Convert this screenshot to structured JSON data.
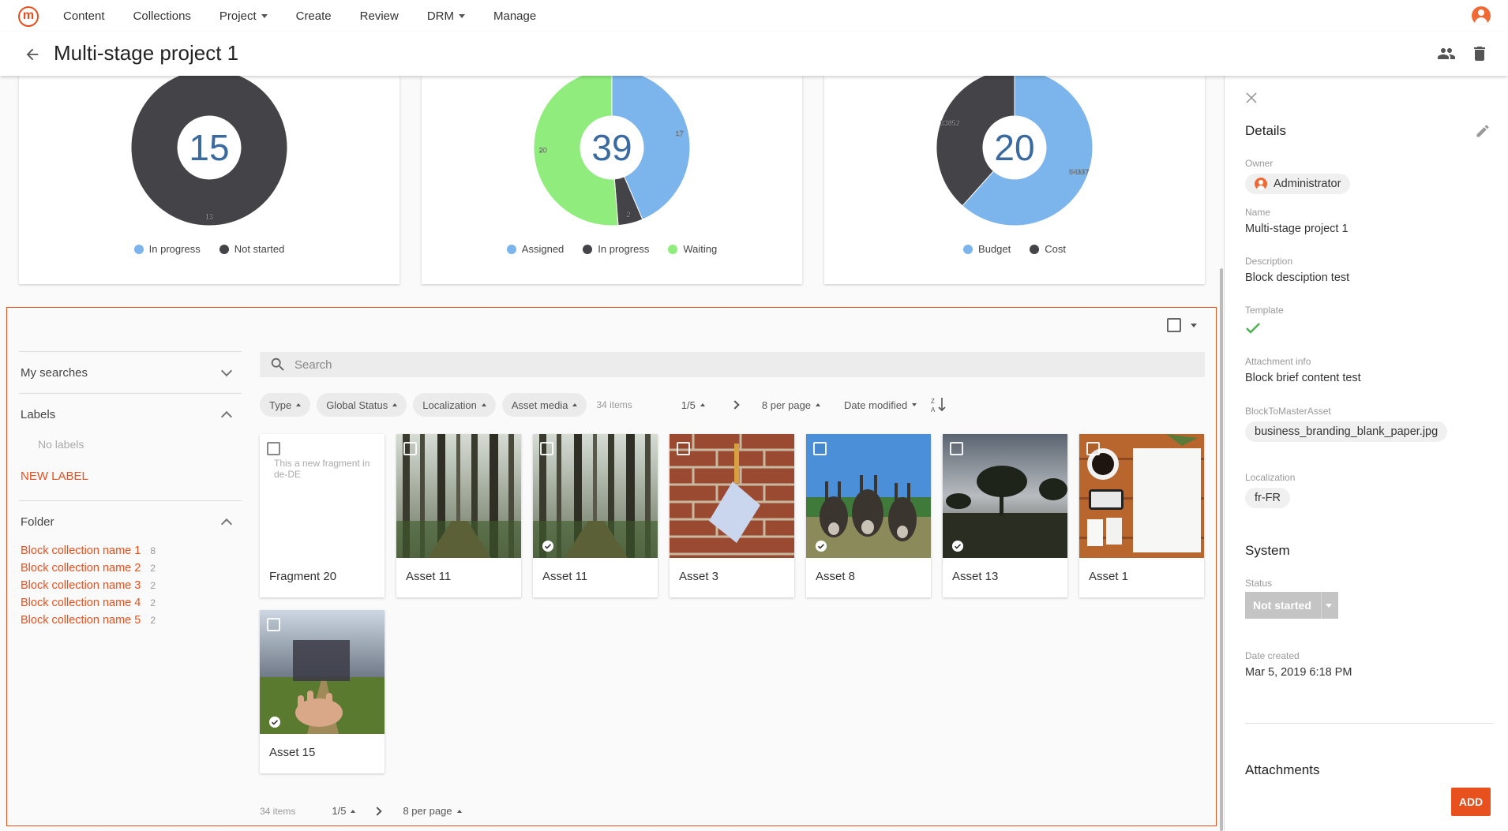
{
  "nav": {
    "logo": "m",
    "items": [
      {
        "label": "Content",
        "caret": false
      },
      {
        "label": "Collections",
        "caret": false
      },
      {
        "label": "Project",
        "caret": true
      },
      {
        "label": "Create",
        "caret": false
      },
      {
        "label": "Review",
        "caret": false
      },
      {
        "label": "DRM",
        "caret": true
      },
      {
        "label": "Manage",
        "caret": false
      }
    ]
  },
  "header": {
    "title": "Multi-stage project 1"
  },
  "charts": {
    "chart_data": [
      {
        "type": "pie",
        "center_label": "15",
        "slices": [
          {
            "label": "In progress",
            "value": 0,
            "color": "#7cb5ec"
          },
          {
            "label": "Not started",
            "value": 13,
            "color": "#434348"
          }
        ],
        "data_labels": [
          "13"
        ],
        "legend": [
          "In progress",
          "Not started"
        ]
      },
      {
        "type": "pie",
        "center_label": "39",
        "slices": [
          {
            "label": "Assigned",
            "value": 17,
            "color": "#7cb5ec"
          },
          {
            "label": "In progress",
            "value": 2,
            "color": "#434348"
          },
          {
            "label": "Waiting",
            "value": 20,
            "color": "#90ed7d"
          }
        ],
        "data_labels": [
          "17",
          "2",
          "20"
        ],
        "legend": [
          "Assigned",
          "In progress",
          "Waiting"
        ]
      },
      {
        "type": "pie",
        "center_label": "20",
        "slices": [
          {
            "label": "Budget",
            "value": 54337,
            "color": "#7cb5ec"
          },
          {
            "label": "Cost",
            "value": 33852,
            "color": "#434348"
          }
        ],
        "data_labels": [
          "54337",
          "33852"
        ],
        "legend": [
          "Budget",
          "Cost"
        ]
      }
    ]
  },
  "filters": {
    "my_searches": "My searches",
    "labels": "Labels",
    "no_labels": "No labels",
    "new_label": "NEW LABEL",
    "folder": "Folder",
    "folders": [
      {
        "name": "Block collection name 1",
        "count": "8"
      },
      {
        "name": "Block collection name 2",
        "count": "2"
      },
      {
        "name": "Block collection name 3",
        "count": "2"
      },
      {
        "name": "Block collection name 4",
        "count": "2"
      },
      {
        "name": "Block collection name 5",
        "count": "2"
      }
    ]
  },
  "search": {
    "placeholder": "Search"
  },
  "toolbar": {
    "chips": [
      "Type",
      "Global Status",
      "Localization",
      "Asset media"
    ],
    "items_count": "34 items",
    "page": "1/5",
    "per_page": "8 per page",
    "sort": "Date modified"
  },
  "assets": [
    {
      "label": "Fragment 20",
      "fragment_text": "This a new fragment in de-DE",
      "approved": false
    },
    {
      "label": "Asset 11",
      "approved": false
    },
    {
      "label": "Asset 11",
      "approved": true
    },
    {
      "label": "Asset 3",
      "approved": false
    },
    {
      "label": "Asset 8",
      "approved": true
    },
    {
      "label": "Asset 13",
      "approved": true
    },
    {
      "label": "Asset 1",
      "approved": false
    },
    {
      "label": "Asset 15",
      "approved": true
    }
  ],
  "bottom_pager": {
    "items_count": "34 items",
    "page": "1/5",
    "per_page": "8 per page"
  },
  "details": {
    "title": "Details",
    "owner_label": "Owner",
    "owner": "Administrator",
    "name_label": "Name",
    "name": "Multi-stage project 1",
    "description_label": "Description",
    "description": "Block desciption test",
    "template_label": "Template",
    "attachment_info_label": "Attachment info",
    "attachment_info": "Block brief content test",
    "block_master_label": "BlockToMasterAsset",
    "block_master": "business_branding_blank_paper.jpg",
    "localization_label": "Localization",
    "localization": "fr-FR",
    "system_title": "System",
    "status_label": "Status",
    "status": "Not started",
    "date_created_label": "Date created",
    "date_created": "Mar 5, 2019 6:18 PM",
    "attachments_title": "Attachments",
    "add_label": "ADD"
  }
}
